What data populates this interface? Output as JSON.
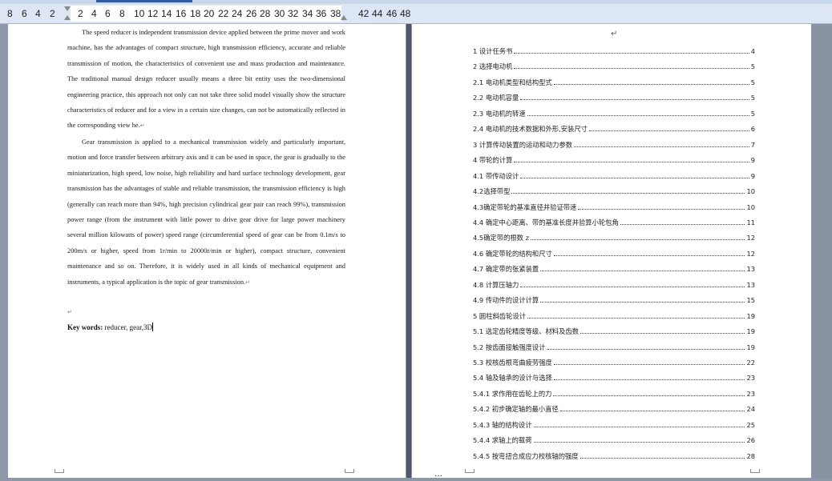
{
  "ruler": {
    "ticks": [
      "8",
      "6",
      "4",
      "2",
      "2",
      "4",
      "6",
      "8",
      "10",
      "12",
      "14",
      "16",
      "18",
      "20",
      "22",
      "24",
      "26",
      "28",
      "30",
      "32",
      "34",
      "36",
      "38",
      "42",
      "44",
      "46",
      "48"
    ]
  },
  "left_page": {
    "paragraph_1": "The speed reducer is independent transmission device applied between the prime mover and work machine, has the advantages of compact structure, high transmission efficiency, accurate and reliable transmission of motion, the characteristics of convenient use and mass production and maintenance. The traditional manual design reducer usually means a three bit entity uses the two-dimensional engineering practice, this approach not only can not take three solid model visually show the structure characteristics of reducer and for a view in a certain size changes, can not be automatically reflected in the corresponding view he.",
    "paragraph_2": "Gear transmission is applied to a mechanical transmission widely and particularly important, motion and force transfer between arbitrary axis and it can be used in space, the gear is gradually to the miniaturization, high speed, low noise, high reliability and hard surface technology development, gear transmission has the advantages of stable and reliable transmission, the transmission efficiency is high (generally can reach more than 94%, high precision cylindrical gear pair can reach 99%), transmission power range (from the instrument with little power to drive gear drive for large power machinery several million kilowatts of power) speed range (circumferential speed of gear can be from 0.1m/s to 200m/s or higher, speed from 1r/min to 20000r/min or higher), compact structure, convenient maintenance and so on. Therefore, it is widely used in all kinds of mechanical equipment and instruments, a typical application is the topic of gear transmission.",
    "keywords_label": "Key words:",
    "keywords_value": " reducer, gear,3D"
  },
  "right_page": {
    "return_mark": "↵",
    "toc": [
      {
        "label": "1  设计任务书",
        "page": "4"
      },
      {
        "label": "2  选择电动机",
        "page": "5"
      },
      {
        "label": "2.1  电动机类型和结构型式",
        "page": "5"
      },
      {
        "label": "2.2  电动机容量",
        "page": "5"
      },
      {
        "label": "2.3  电动机的转速",
        "page": "5"
      },
      {
        "label": "2.4  电动机的技术数据和外形,安装尺寸",
        "page": "6"
      },
      {
        "label": "3  计算传动装置的运动和动力参数",
        "page": "7"
      },
      {
        "label": "4  带轮的计算",
        "page": "9"
      },
      {
        "label": "4.1  带传动设计",
        "page": "9"
      },
      {
        "label": "4.2选择带型",
        "page": "10"
      },
      {
        "label": "4.3确定带轮的基准直径并验证带速",
        "page": "10"
      },
      {
        "label": "4.4  确定中心距离、带的基准长度并验算小轮包角",
        "page": "11"
      },
      {
        "label": "4.5确定带的根数 z",
        "page": "12"
      },
      {
        "label": "4.6  确定带轮的结构和尺寸",
        "page": "12"
      },
      {
        "label": "4.7  确定带的张紧装置",
        "page": "13"
      },
      {
        "label": "4.8  计算压轴力",
        "page": "13"
      },
      {
        "label": "4.9  传动件的设计计算",
        "page": "15"
      },
      {
        "label": "5  圆柱斜齿轮设计",
        "page": "19"
      },
      {
        "label": "5.1  选定齿轮精度等级、材料及齿数",
        "page": "19"
      },
      {
        "label": "5.2  按齿面接触强度设计",
        "page": "19"
      },
      {
        "label": "5.3  校核齿根弯曲疲劳强度",
        "page": "22"
      },
      {
        "label": "5.4  轴及轴承的设计与选择",
        "page": "23"
      },
      {
        "label": "5.4.1 求作用在齿轮上的力",
        "page": "23"
      },
      {
        "label": "5.4.2  初步确定轴的最小直径",
        "page": "24"
      },
      {
        "label": "5.4.3  轴的结构设计",
        "page": "25"
      },
      {
        "label": "5.4.4  求轴上的载荷",
        "page": "26"
      },
      {
        "label": "5.4.5  按弯扭合成应力校核轴的强度",
        "page": "28"
      }
    ]
  }
}
